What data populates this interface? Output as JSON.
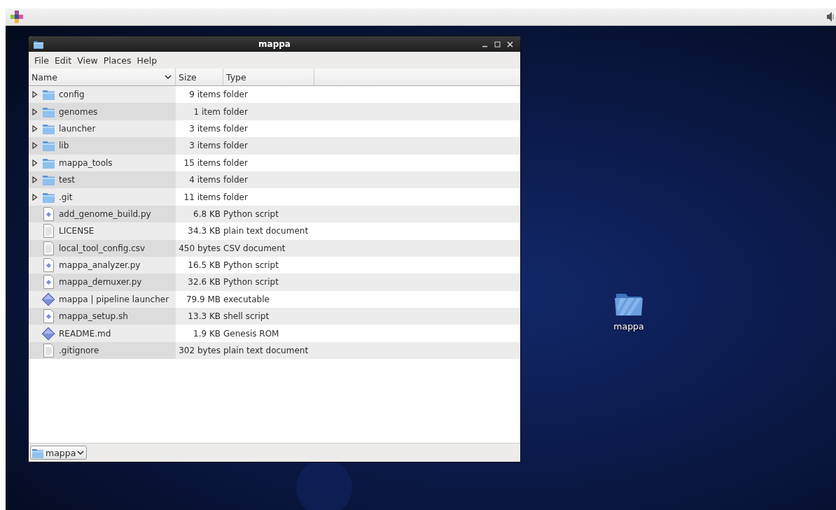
{
  "window": {
    "title": "mappa"
  },
  "menu": [
    "File",
    "Edit",
    "View",
    "Places",
    "Help"
  ],
  "columns": [
    {
      "label": "Name",
      "sorted": true
    },
    {
      "label": "Size",
      "sorted": false
    },
    {
      "label": "Type",
      "sorted": false
    }
  ],
  "rows": [
    {
      "kind": "folder",
      "expanded": false,
      "name": "config",
      "size": "9 items",
      "type": "folder"
    },
    {
      "kind": "folder",
      "expanded": false,
      "name": "genomes",
      "size": "1 item",
      "type": "folder"
    },
    {
      "kind": "folder",
      "expanded": false,
      "name": "launcher",
      "size": "3 items",
      "type": "folder"
    },
    {
      "kind": "folder",
      "expanded": false,
      "name": "lib",
      "size": "3 items",
      "type": "folder"
    },
    {
      "kind": "folder",
      "expanded": false,
      "name": "mappa_tools",
      "size": "15 items",
      "type": "folder"
    },
    {
      "kind": "folder",
      "expanded": false,
      "name": "test",
      "size": "4 items",
      "type": "folder"
    },
    {
      "kind": "folder",
      "expanded": false,
      "name": ".git",
      "size": "11 items",
      "type": "folder"
    },
    {
      "kind": "script",
      "name": "add_genome_build.py",
      "size": "6.8 KB",
      "type": "Python script"
    },
    {
      "kind": "text",
      "name": "LICENSE",
      "size": "34.3 KB",
      "type": "plain text document"
    },
    {
      "kind": "text",
      "name": "local_tool_config.csv",
      "size": "450 bytes",
      "type": "CSV document"
    },
    {
      "kind": "script",
      "name": "mappa_analyzer.py",
      "size": "16.5 KB",
      "type": "Python script"
    },
    {
      "kind": "script",
      "name": "mappa_demuxer.py",
      "size": "32.6 KB",
      "type": "Python script"
    },
    {
      "kind": "binary",
      "name": "mappa | pipeline launcher",
      "size": "79.9 MB",
      "type": "executable"
    },
    {
      "kind": "script",
      "name": "mappa_setup.sh",
      "size": "13.3 KB",
      "type": "shell script"
    },
    {
      "kind": "binary",
      "name": "README.md",
      "size": "1.9 KB",
      "type": "Genesis ROM"
    },
    {
      "kind": "text",
      "name": ".gitignore",
      "size": "302 bytes",
      "type": "plain text document"
    }
  ],
  "location": {
    "label": "mappa"
  },
  "desktop_icons": [
    {
      "label": "mappa"
    }
  ]
}
